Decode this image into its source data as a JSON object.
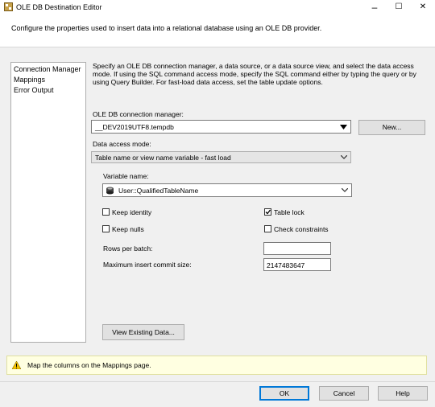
{
  "window": {
    "title": "OLE DB Destination Editor",
    "minimize": "–",
    "maximize": "☐",
    "close": "✕"
  },
  "header": {
    "text": "Configure the properties used to insert data into a relational database using an OLE DB provider."
  },
  "sidebar": {
    "items": [
      {
        "label": "Connection Manager"
      },
      {
        "label": "Mappings"
      },
      {
        "label": "Error Output"
      }
    ]
  },
  "main": {
    "description": "Specify an OLE DB connection manager, a data source, or a data source view, and select the data access mode. If using the SQL command access mode, specify the SQL command either by typing the query or by using Query Builder. For fast-load data access, set the table update options.",
    "connection_manager_label": "OLE DB connection manager:",
    "connection_manager_value": "__DEV2019UTF8.tempdb",
    "new_button": "New...",
    "data_access_mode_label": "Data access mode:",
    "data_access_mode_value": "Table name or view name variable - fast load",
    "variable_name_label": "Variable name:",
    "variable_name_value": "User::QualifiedTableName",
    "options": {
      "keep_identity": {
        "label": "Keep identity",
        "checked": false
      },
      "table_lock": {
        "label": "Table lock",
        "checked": true
      },
      "keep_nulls": {
        "label": "Keep nulls",
        "checked": false
      },
      "check_constraints": {
        "label": "Check constraints",
        "checked": false
      }
    },
    "rows_per_batch_label": "Rows per batch:",
    "rows_per_batch_value": "",
    "max_commit_label": "Maximum insert commit size:",
    "max_commit_value": "2147483647",
    "view_existing_button": "View Existing Data..."
  },
  "message": {
    "text": "Map the columns on the Mappings page."
  },
  "footer": {
    "ok": "OK",
    "cancel": "Cancel",
    "help": "Help"
  },
  "colors": {
    "accent": "#0078d7",
    "warning": "#f2c200",
    "message_bg": "#ffffe1"
  }
}
